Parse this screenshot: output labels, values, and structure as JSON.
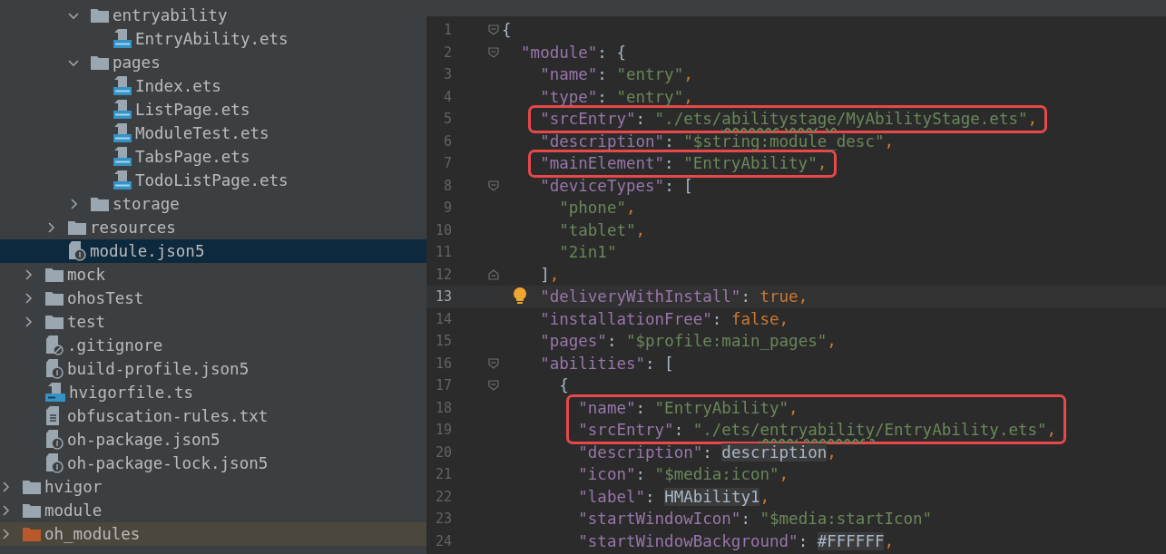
{
  "tree": [
    {
      "children": [
        {
          "children": [
            {
              "children": [
                {
                  "label": "entryability",
                  "kind": "folder",
                  "expanded": true,
                  "selected": false,
                  "children": [
                    {
                      "label": "EntryAbility.ets",
                      "kind": "ets",
                      "selected": false
                    }
                  ]
                },
                {
                  "label": "pages",
                  "kind": "folder",
                  "expanded": true,
                  "selected": false,
                  "children": [
                    {
                      "label": "Index.ets",
                      "kind": "ets",
                      "selected": false
                    },
                    {
                      "label": "ListPage.ets",
                      "kind": "ets",
                      "selected": false
                    },
                    {
                      "label": "ModuleTest.ets",
                      "kind": "ets",
                      "selected": false
                    },
                    {
                      "label": "TabsPage.ets",
                      "kind": "ets",
                      "selected": false
                    },
                    {
                      "label": "TodoListPage.ets",
                      "kind": "ets",
                      "selected": false
                    }
                  ]
                },
                {
                  "label": "storage",
                  "kind": "folder",
                  "expanded": false,
                  "selected": false
                }
              ]
            },
            {
              "label": "resources",
              "kind": "folder",
              "expanded": false,
              "selected": false
            },
            {
              "label": "module.json5",
              "kind": "json5",
              "selected": true
            }
          ]
        },
        {
          "label": "mock",
          "kind": "folder",
          "expanded": false,
          "selected": false
        },
        {
          "label": "ohosTest",
          "kind": "folder",
          "expanded": false,
          "selected": false
        },
        {
          "label": "test",
          "kind": "folder",
          "expanded": false,
          "selected": false
        },
        {
          "label": ".gitignore",
          "kind": "gitignore",
          "selected": false
        },
        {
          "label": "build-profile.json5",
          "kind": "json5",
          "selected": false
        },
        {
          "label": "hvigorfile.ts",
          "kind": "ts",
          "selected": false
        },
        {
          "label": "obfuscation-rules.txt",
          "kind": "text",
          "selected": false
        },
        {
          "label": "oh-package.json5",
          "kind": "json5",
          "selected": false
        },
        {
          "label": "oh-package-lock.json5",
          "kind": "json5",
          "selected": false
        }
      ]
    },
    {
      "label": "hvigor",
      "kind": "folder",
      "expanded": false,
      "selected": false
    },
    {
      "label": "module",
      "kind": "folder",
      "expanded": false,
      "selected": false
    },
    {
      "label": "oh_modules",
      "kind": "excluded-folder",
      "expanded": false,
      "selected": false
    }
  ],
  "editor": {
    "lines": [
      {
        "number": "1",
        "kind": "fold-start",
        "boxed": false,
        "current": false,
        "tokens": [
          {
            "kind": "punct",
            "text": "{"
          }
        ]
      },
      {
        "number": "2",
        "kind": "fold-start",
        "boxed": false,
        "current": false,
        "tokens": [
          {
            "kind": "key",
            "text": "  \"module\""
          },
          {
            "kind": "punct",
            "text": ": {"
          }
        ]
      },
      {
        "number": "3",
        "boxed": false,
        "current": false,
        "tokens": [
          {
            "kind": "key",
            "text": "    \"name\""
          },
          {
            "kind": "punct",
            "text": ": "
          },
          {
            "kind": "string",
            "text": "\"entry\""
          },
          {
            "kind": "comma",
            "text": ","
          }
        ]
      },
      {
        "number": "4",
        "boxed": false,
        "current": false,
        "tokens": [
          {
            "kind": "key",
            "text": "    \"type\""
          },
          {
            "kind": "punct",
            "text": ": "
          },
          {
            "kind": "string",
            "text": "\"entry\""
          },
          {
            "kind": "comma",
            "text": ","
          }
        ]
      },
      {
        "number": "5",
        "boxed": true,
        "current": false,
        "tokens": [
          {
            "kind": "key",
            "text": "    \"srcEntry\""
          },
          {
            "kind": "punct",
            "text": ": "
          },
          {
            "kind": "string",
            "text": "\"./ets/"
          },
          {
            "kind": "typo",
            "text": "abilitystage"
          },
          {
            "kind": "string",
            "text": "/MyAbilityStage.ets\""
          },
          {
            "kind": "comma",
            "text": ","
          }
        ]
      },
      {
        "number": "6",
        "boxed": false,
        "current": false,
        "tokens": [
          {
            "kind": "key",
            "text": "    \"description\""
          },
          {
            "kind": "punct",
            "text": ": "
          },
          {
            "kind": "string",
            "text": "\"$string:module_desc\""
          },
          {
            "kind": "comma",
            "text": ","
          }
        ]
      },
      {
        "number": "7",
        "boxed": true,
        "current": false,
        "tokens": [
          {
            "kind": "key",
            "text": "    \"mainElement\""
          },
          {
            "kind": "punct",
            "text": ": "
          },
          {
            "kind": "string",
            "text": "\"EntryAbility\""
          },
          {
            "kind": "comma",
            "text": ","
          }
        ]
      },
      {
        "number": "8",
        "kind": "fold-start",
        "boxed": false,
        "current": false,
        "tokens": [
          {
            "kind": "key",
            "text": "    \"deviceTypes\""
          },
          {
            "kind": "punct",
            "text": ": ["
          }
        ]
      },
      {
        "number": "9",
        "boxed": false,
        "current": false,
        "tokens": [
          {
            "kind": "string",
            "text": "      \"phone\""
          },
          {
            "kind": "comma",
            "text": ","
          }
        ]
      },
      {
        "number": "10",
        "boxed": false,
        "current": false,
        "tokens": [
          {
            "kind": "string",
            "text": "      \"tablet\""
          },
          {
            "kind": "comma",
            "text": ","
          }
        ]
      },
      {
        "number": "11",
        "boxed": false,
        "current": false,
        "tokens": [
          {
            "kind": "string",
            "text": "      \"2in1\""
          }
        ]
      },
      {
        "number": "12",
        "kind": "fold-end",
        "boxed": false,
        "current": false,
        "tokens": [
          {
            "kind": "punct",
            "text": "    ]"
          },
          {
            "kind": "comma",
            "text": ","
          }
        ]
      },
      {
        "number": "13",
        "boxed": false,
        "current": true,
        "hint": true,
        "tokens": [
          {
            "kind": "key",
            "text": "    \"deliveryWithInstall\""
          },
          {
            "kind": "punct",
            "text": ": "
          },
          {
            "kind": "keyword",
            "text": "true"
          },
          {
            "kind": "comma",
            "text": ","
          }
        ]
      },
      {
        "number": "14",
        "boxed": false,
        "current": false,
        "tokens": [
          {
            "kind": "key",
            "text": "    \"installationFree\""
          },
          {
            "kind": "punct",
            "text": ": "
          },
          {
            "kind": "keyword",
            "text": "false"
          },
          {
            "kind": "comma",
            "text": ","
          }
        ]
      },
      {
        "number": "15",
        "boxed": false,
        "current": false,
        "tokens": [
          {
            "kind": "key",
            "text": "    \"pages\""
          },
          {
            "kind": "punct",
            "text": ": "
          },
          {
            "kind": "string",
            "text": "\"$profile:main_pages\""
          },
          {
            "kind": "comma",
            "text": ","
          }
        ]
      },
      {
        "number": "16",
        "kind": "fold-start",
        "boxed": false,
        "current": false,
        "tokens": [
          {
            "kind": "key",
            "text": "    \"abilities\""
          },
          {
            "kind": "punct",
            "text": ": ["
          }
        ]
      },
      {
        "number": "17",
        "kind": "fold-start",
        "boxed": false,
        "current": false,
        "tokens": [
          {
            "kind": "punct",
            "text": "      {"
          }
        ]
      },
      {
        "number": "18",
        "boxed": true,
        "current": false,
        "tokens": [
          {
            "kind": "key",
            "text": "        \"name\""
          },
          {
            "kind": "punct",
            "text": ": "
          },
          {
            "kind": "string",
            "text": "\"EntryAbility\""
          },
          {
            "kind": "comma",
            "text": ","
          }
        ]
      },
      {
        "number": "19",
        "boxed": true,
        "current": false,
        "tokens": [
          {
            "kind": "key",
            "text": "        \"srcEntry\""
          },
          {
            "kind": "punct",
            "text": ": "
          },
          {
            "kind": "string",
            "text": "\"./ets/"
          },
          {
            "kind": "typo",
            "text": "entryability"
          },
          {
            "kind": "string",
            "text": "/EntryAbility.ets\""
          },
          {
            "kind": "comma",
            "text": ","
          }
        ]
      },
      {
        "number": "20",
        "boxed": false,
        "current": false,
        "tokens": [
          {
            "kind": "key",
            "text": "        \"description\""
          },
          {
            "kind": "punct",
            "text": ": "
          },
          {
            "kind": "ref",
            "text": "description"
          },
          {
            "kind": "comma",
            "text": ","
          }
        ]
      },
      {
        "number": "21",
        "boxed": false,
        "current": false,
        "tokens": [
          {
            "kind": "key",
            "text": "        \"icon\""
          },
          {
            "kind": "punct",
            "text": ": "
          },
          {
            "kind": "string",
            "text": "\"$media:icon\""
          },
          {
            "kind": "comma",
            "text": ","
          }
        ]
      },
      {
        "number": "22",
        "boxed": false,
        "current": false,
        "tokens": [
          {
            "kind": "key",
            "text": "        \"label\""
          },
          {
            "kind": "punct",
            "text": ": "
          },
          {
            "kind": "ref",
            "text": "HMAbility1"
          },
          {
            "kind": "comma",
            "text": ","
          }
        ]
      },
      {
        "number": "23",
        "boxed": false,
        "current": false,
        "tokens": [
          {
            "kind": "key",
            "text": "        \"startWindowIcon\""
          },
          {
            "kind": "punct",
            "text": ": "
          },
          {
            "kind": "string",
            "text": "\"$media:startIcon\""
          }
        ]
      },
      {
        "number": "24",
        "boxed": false,
        "current": false,
        "tokens": [
          {
            "kind": "key",
            "text": "        \"startWindowBackground\""
          },
          {
            "kind": "punct",
            "text": ": "
          },
          {
            "kind": "ref",
            "text": "#FFFFFF"
          },
          {
            "kind": "comma",
            "text": ","
          }
        ]
      }
    ]
  }
}
